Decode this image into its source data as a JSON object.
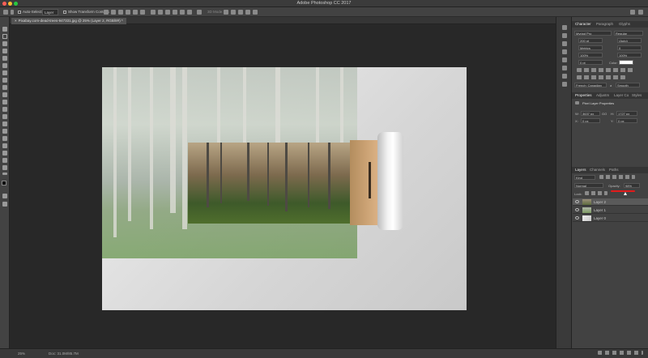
{
  "window": {
    "title": "Adobe Photoshop CC 2017"
  },
  "options_bar": {
    "auto_select_label": "Auto-Select:",
    "auto_select_value": "Layer",
    "transform_controls_label": "Show Transform Controls",
    "mode_label": "3D Mode:"
  },
  "document_tab": {
    "label": "Pixabay.com-dead-trees-947331.jpg @ 25% (Layer 2, RGB/8#) *"
  },
  "status_bar": {
    "zoom": "25%",
    "doc_info": "Doc: 31.0M/85.7M"
  },
  "character_panel": {
    "tabs": [
      "Character",
      "Paragraph",
      "Glyphs"
    ],
    "font_family": "Myriad Pro",
    "font_style": "Regular",
    "font_size": "200 pt",
    "leading": "(Auto)",
    "kerning": "Metrics",
    "tracking": "0",
    "vertical_scale": "100%",
    "horizontal_scale": "100%",
    "baseline": "0 pt",
    "color_label": "Color:",
    "language": "French: Canadian",
    "aa_label": "a",
    "aa_value": "Smooth"
  },
  "properties_panel": {
    "tabs": [
      "Properties",
      "Adjustm",
      "Layer Co",
      "Styles"
    ],
    "heading": "Pixel Layer Properties",
    "w_label": "W:",
    "w_value": "3637 px",
    "h_label": "H:",
    "h_value": "1727 px",
    "go_label": "GO",
    "x_label": "X:",
    "x_value": "0 px",
    "y_label": "Y:",
    "y_value": "0 px"
  },
  "layers_panel": {
    "tabs": [
      "Layers",
      "Channels",
      "Paths"
    ],
    "filter_value": "Kind",
    "blend_mode": "Normal",
    "opacity_label": "Opacity:",
    "opacity_value": "98%",
    "lock_label": "Lock:",
    "fill_label": "Fill:",
    "fill_value": "100%",
    "layers": [
      {
        "name": "Layer 2",
        "selected": true
      },
      {
        "name": "Layer 1",
        "selected": false
      },
      {
        "name": "Layer 0",
        "selected": false
      }
    ]
  },
  "colors": {
    "accent_red": "#e21b1b",
    "panel_bg": "#424242",
    "canvas_bg": "#282828"
  }
}
